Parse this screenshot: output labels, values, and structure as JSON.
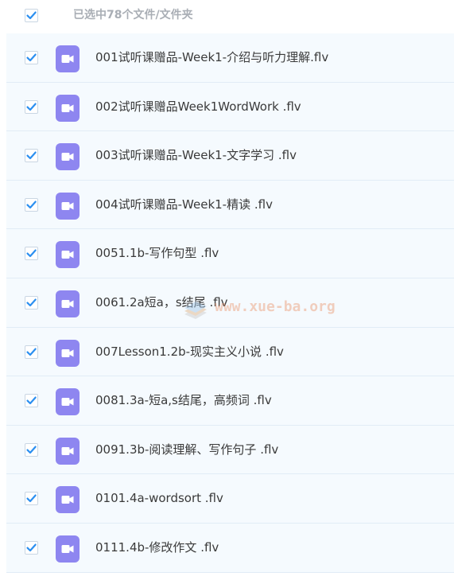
{
  "header": {
    "title": "已选中78个文件/文件夹"
  },
  "colors": {
    "accent": "#2b8ff0",
    "file_icon": "#8e86f0",
    "row_bg": "#f5fafe",
    "header_text": "#a9aeb5"
  },
  "files": [
    {
      "name": "001试听课赠品-Week1-介绍与听力理解.flv",
      "checked": true,
      "icon": "video-file-icon"
    },
    {
      "name": "002试听课赠品Week1WordWork .flv",
      "checked": true,
      "icon": "video-file-icon"
    },
    {
      "name": "003试听课赠品-Week1-文字学习 .flv",
      "checked": true,
      "icon": "video-file-icon"
    },
    {
      "name": "004试听课赠品-Week1-精读 .flv",
      "checked": true,
      "icon": "video-file-icon"
    },
    {
      "name": "0051.1b-写作句型 .flv",
      "checked": true,
      "icon": "video-file-icon"
    },
    {
      "name": "0061.2a短a，s结尾 .flv",
      "checked": true,
      "icon": "video-file-icon"
    },
    {
      "name": "007Lesson1.2b-现实主义小说 .flv",
      "checked": true,
      "icon": "video-file-icon"
    },
    {
      "name": "0081.3a-短a,s结尾，高频词 .flv",
      "checked": true,
      "icon": "video-file-icon"
    },
    {
      "name": "0091.3b-阅读理解、写作句子 .flv",
      "checked": true,
      "icon": "video-file-icon"
    },
    {
      "name": "0101.4a-wordsort .flv",
      "checked": true,
      "icon": "video-file-icon"
    },
    {
      "name": "0111.4b-修改作文 .flv",
      "checked": true,
      "icon": "video-file-icon"
    }
  ],
  "watermark": {
    "text": "www.xue-ba.org"
  }
}
